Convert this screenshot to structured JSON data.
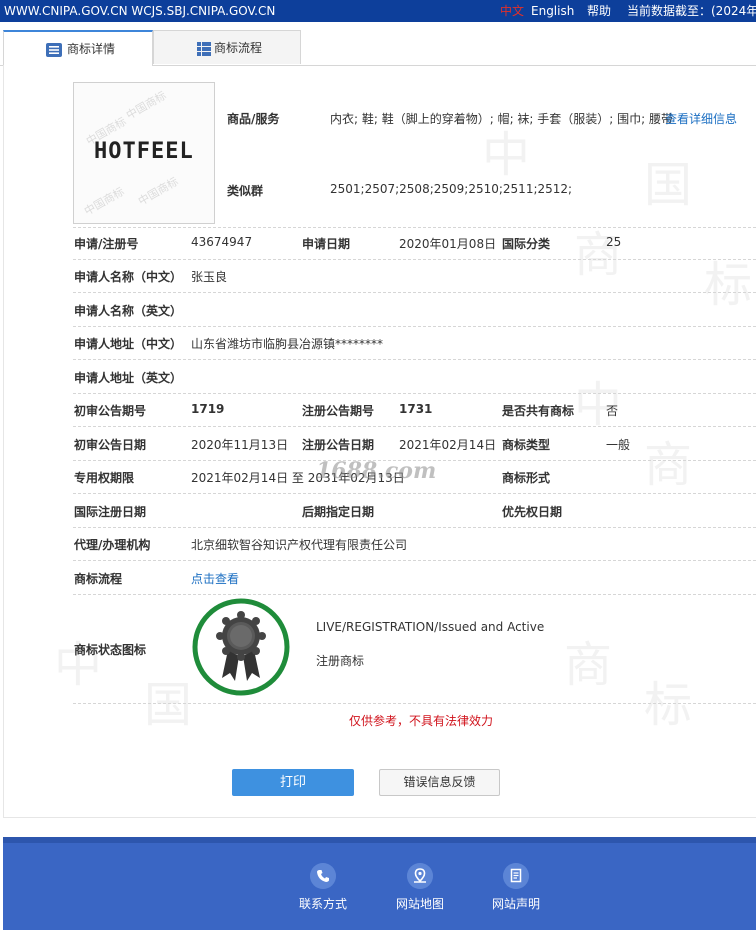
{
  "topbar": {
    "url": "WWW.CNIPA.GOV.CN WCJS.SBJ.CNIPA.GOV.CN",
    "lang_zh": "中文",
    "lang_en": "English",
    "help": "帮助",
    "date_label": "当前数据截至：(2024年"
  },
  "tabs": [
    {
      "label": "商标详情",
      "icon": "list-icon"
    },
    {
      "label": "商标流程",
      "icon": "grid-icon"
    }
  ],
  "trademark": {
    "logo_text": "HOTFEEL",
    "logo_watermark": "中国商标",
    "goods_label": "商品/服务",
    "goods_value": "内衣; 鞋; 鞋（脚上的穿着物）; 帽; 袜; 手套（服装）; 围巾; 腰带",
    "goods_link": "查看详细信息",
    "similar_label": "类似群",
    "similar_value": "2501;2507;2508;2509;2510;2511;2512;"
  },
  "details": {
    "reg_no_label": "申请/注册号",
    "reg_no": "43674947",
    "app_date_label": "申请日期",
    "app_date": "2020年01月08日",
    "intl_class_label": "国际分类",
    "intl_class": "25",
    "applicant_cn_label": "申请人名称（中文）",
    "applicant_cn": "张玉良",
    "applicant_en_label": "申请人名称（英文）",
    "applicant_en": "",
    "address_cn_label": "申请人地址（中文）",
    "address_cn": "山东省潍坊市临朐县冶源镇********",
    "address_en_label": "申请人地址（英文）",
    "address_en": "",
    "prelim_no_label": "初审公告期号",
    "prelim_no": "1719",
    "reg_pub_no_label": "注册公告期号",
    "reg_pub_no": "1731",
    "shared_label": "是否共有商标",
    "shared": "否",
    "prelim_date_label": "初审公告日期",
    "prelim_date": "2020年11月13日",
    "reg_pub_date_label": "注册公告日期",
    "reg_pub_date": "2021年02月14日",
    "tm_type_label": "商标类型",
    "tm_type": "一般",
    "exclusive_label": "专用权期限",
    "exclusive": "2021年02月14日 至 2031年02月13日",
    "tm_form_label": "商标形式",
    "tm_form": "",
    "intl_reg_label": "国际注册日期",
    "intl_reg": "",
    "later_label": "后期指定日期",
    "later": "",
    "priority_label": "优先权日期",
    "priority": "",
    "agent_label": "代理/办理机构",
    "agent": "北京细软智谷知识产权代理有限责任公司",
    "flow_label": "商标流程",
    "flow_link": "点击查看",
    "status_label": "商标状态图标",
    "status_en": "LIVE/REGISTRATION/Issued and Active",
    "status_zh": "注册商标"
  },
  "watermarks": {
    "site": "1688.com",
    "bg_char_1": "中",
    "bg_char_2": "国",
    "bg_char_3": "商",
    "bg_char_4": "标"
  },
  "notice": "仅供参考，不具有法律效力",
  "buttons": {
    "print": "打印",
    "feedback": "错误信息反馈"
  },
  "footer": [
    {
      "label": "联系方式",
      "icon": "phone-icon"
    },
    {
      "label": "网站地图",
      "icon": "map-pin-icon"
    },
    {
      "label": "网站声明",
      "icon": "document-icon"
    }
  ],
  "colors": {
    "topbar": "#0d3f9b",
    "accent": "#3e91e0",
    "footer": "#3a66c4",
    "badge_ring": "#1f8c3a",
    "notice": "#d0121b"
  }
}
